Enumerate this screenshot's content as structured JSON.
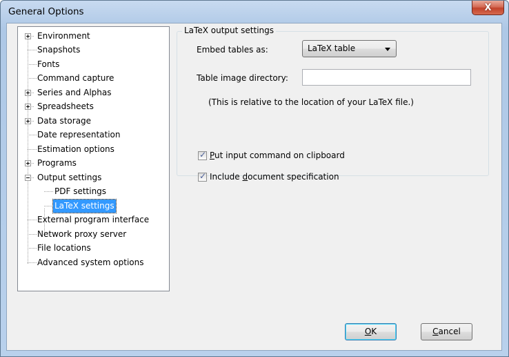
{
  "window": {
    "title": "General Options",
    "close_glyph": "X"
  },
  "tree": {
    "items": [
      {
        "label": "Environment",
        "expander": "plus"
      },
      {
        "label": "Snapshots"
      },
      {
        "label": "Fonts"
      },
      {
        "label": "Command capture"
      },
      {
        "label": "Series and Alphas",
        "expander": "plus"
      },
      {
        "label": "Spreadsheets",
        "expander": "plus"
      },
      {
        "label": "Data storage",
        "expander": "plus"
      },
      {
        "label": "Date representation"
      },
      {
        "label": "Estimation options"
      },
      {
        "label": "Programs",
        "expander": "plus"
      },
      {
        "label": "Output settings",
        "expander": "minus"
      },
      {
        "label": "PDF settings",
        "child": true
      },
      {
        "label": "LaTeX settings",
        "child": true,
        "selected": true
      },
      {
        "label": "External program interface"
      },
      {
        "label": "Network proxy server"
      },
      {
        "label": "File locations"
      },
      {
        "label": "Advanced system options"
      }
    ]
  },
  "latex": {
    "group_title": "LaTeX output settings",
    "embed_label": "Embed tables as:",
    "embed_value": "LaTeX table",
    "dir_label": "Table image directory:",
    "dir_value": "",
    "note": "(This is relative to the location of your LaTeX file.)",
    "cb1": {
      "pre": "",
      "mn": "P",
      "post": "ut input command on clipboard",
      "checked": true
    },
    "cb2": {
      "pre": "Include ",
      "mn": "d",
      "post": "ocument specification",
      "checked": true
    }
  },
  "buttons": {
    "ok": {
      "pre": "",
      "mn": "O",
      "post": "K"
    },
    "cancel": {
      "pre": "",
      "mn": "C",
      "post": "ancel"
    }
  },
  "colors": {
    "selection": "#3399ff",
    "face": "#f0f0f0"
  },
  "icons": {
    "close": "close-icon",
    "dropdown": "chevron-down-icon",
    "check": "check-icon"
  }
}
